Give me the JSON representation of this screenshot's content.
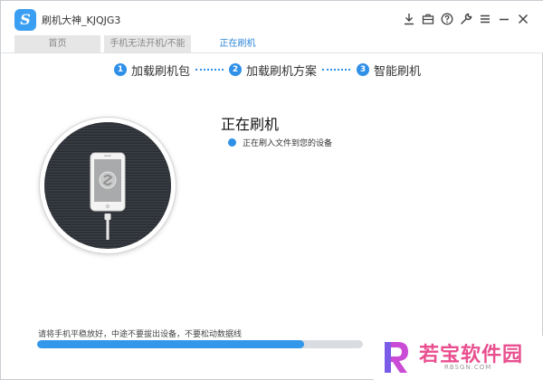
{
  "window": {
    "title": "刷机大神_KJQJG3",
    "logo_letter": "S"
  },
  "title_icons": [
    "download-icon",
    "briefcase-icon",
    "help-icon",
    "wrench-icon",
    "menu-icon",
    "minimize-icon",
    "close-icon"
  ],
  "tabs": [
    {
      "label": "首页",
      "active": false
    },
    {
      "label": "手机无法开机/不能",
      "active": false
    },
    {
      "label": "正在刷机",
      "active": true
    }
  ],
  "steps": [
    {
      "num": "1",
      "label": "加载刷机包"
    },
    {
      "num": "2",
      "label": "加载刷机方案"
    },
    {
      "num": "3",
      "label": "智能刷机"
    }
  ],
  "main": {
    "title": "正在刷机",
    "status": "正在刷入文件到您的设备"
  },
  "footer": {
    "hint": "请将手机平稳放好，中途不要拔出设备，不要松动数据线",
    "progress": 0.82
  },
  "watermark": {
    "text": "若宝软件园",
    "sub": "RBSGN.COM"
  },
  "colors": {
    "accent": "#2f90e8",
    "progress": "#3498ea",
    "watermark": "#e94f8f"
  }
}
